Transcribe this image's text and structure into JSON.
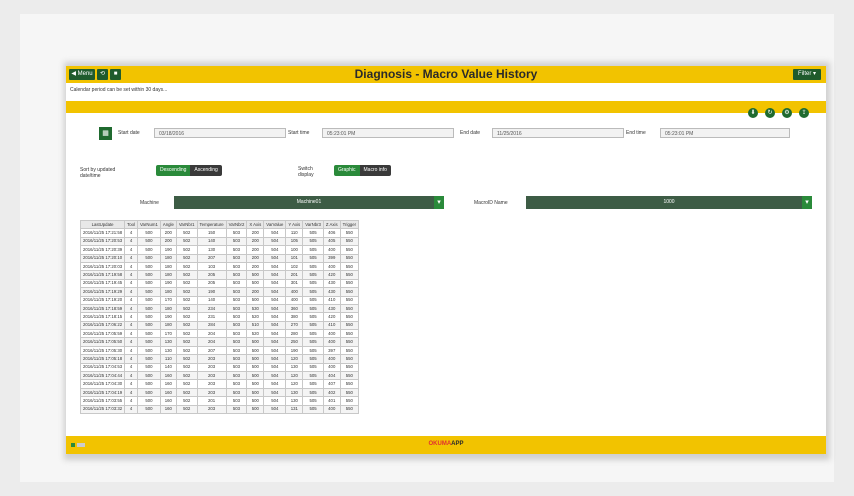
{
  "window": {
    "title": "Diagnosis - Macro Value History",
    "left_buttons": [
      "◀ Menu",
      "⟲",
      "■"
    ],
    "right_button": "Filter ▾",
    "info_text": "Calendar period can be set within 30 days..."
  },
  "toolbar": {
    "icons": [
      "download-icon",
      "refresh-icon",
      "settings-icon",
      "export-icon"
    ]
  },
  "filters": {
    "start_date_label": "Start date",
    "start_date": "03/18/2016",
    "start_time_label": "Start time",
    "start_time": "05:23:01 PM",
    "end_date_label": "End date",
    "end_date": "11/25/2016",
    "end_time_label": "End time",
    "end_time": "05:23:01 PM",
    "sort_label": "Sort by updated date/time",
    "sort_on": "Descending",
    "sort_off": "Ascending",
    "switch_label": "Switch display",
    "switch_on": "Graphic",
    "switch_off": "Macro info",
    "machine_label": "Machine",
    "machine_value": "Machine01",
    "macro_label": "MacroID Name",
    "macro_value": "1000"
  },
  "table": {
    "headers": [
      "LastUpdate",
      "Tool",
      "VarNum1",
      "Angle",
      "VarNbr1",
      "Temperature",
      "VarNbr2",
      "X Axis",
      "VarValue",
      "Y Axis",
      "VarNbr3",
      "Z Axis",
      "Trigger"
    ],
    "rows": [
      [
        "2016/11/25 17:21:58",
        "4",
        "500",
        "200",
        "502",
        "150",
        "503",
        "200",
        "504",
        "110",
        "505",
        "406",
        "550"
      ],
      [
        "2016/11/25 17:20:53",
        "4",
        "500",
        "200",
        "502",
        "140",
        "503",
        "200",
        "504",
        "105",
        "505",
        "405",
        "550"
      ],
      [
        "2016/11/25 17:20:39",
        "4",
        "500",
        "190",
        "502",
        "130",
        "503",
        "200",
        "504",
        "100",
        "505",
        "400",
        "550"
      ],
      [
        "2016/11/25 17:20:10",
        "4",
        "500",
        "180",
        "502",
        "207",
        "503",
        "200",
        "504",
        "101",
        "505",
        "399",
        "550"
      ],
      [
        "2016/11/25 17:20:03",
        "4",
        "500",
        "180",
        "502",
        "103",
        "503",
        "200",
        "504",
        "102",
        "505",
        "400",
        "550"
      ],
      [
        "2016/11/25 17:19:58",
        "4",
        "500",
        "180",
        "502",
        "205",
        "503",
        "500",
        "504",
        "201",
        "505",
        "420",
        "550"
      ],
      [
        "2016/11/25 17:19:45",
        "4",
        "500",
        "190",
        "502",
        "205",
        "503",
        "500",
        "504",
        "301",
        "505",
        "430",
        "550"
      ],
      [
        "2016/11/25 17:19:29",
        "4",
        "500",
        "180",
        "502",
        "190",
        "503",
        "200",
        "504",
        "400",
        "505",
        "430",
        "550"
      ],
      [
        "2016/11/25 17:19:20",
        "4",
        "500",
        "170",
        "502",
        "140",
        "503",
        "500",
        "504",
        "400",
        "505",
        "410",
        "550"
      ],
      [
        "2016/11/25 17:18:59",
        "4",
        "500",
        "180",
        "502",
        "234",
        "503",
        "530",
        "504",
        "360",
        "505",
        "430",
        "550"
      ],
      [
        "2016/11/25 17:18:15",
        "4",
        "500",
        "190",
        "502",
        "231",
        "503",
        "520",
        "504",
        "380",
        "505",
        "420",
        "550"
      ],
      [
        "2016/11/25 17:06:22",
        "4",
        "500",
        "180",
        "502",
        "284",
        "503",
        "510",
        "504",
        "270",
        "505",
        "410",
        "550"
      ],
      [
        "2016/11/25 17:05:59",
        "4",
        "500",
        "170",
        "502",
        "204",
        "503",
        "520",
        "504",
        "280",
        "505",
        "400",
        "550"
      ],
      [
        "2016/11/25 17:05:50",
        "4",
        "500",
        "130",
        "502",
        "204",
        "503",
        "500",
        "504",
        "250",
        "505",
        "400",
        "550"
      ],
      [
        "2016/11/25 17:05:30",
        "4",
        "500",
        "130",
        "502",
        "207",
        "503",
        "500",
        "504",
        "190",
        "505",
        "397",
        "550"
      ],
      [
        "2016/11/25 17:05:18",
        "4",
        "500",
        "110",
        "502",
        "203",
        "503",
        "500",
        "504",
        "120",
        "505",
        "400",
        "550"
      ],
      [
        "2016/11/25 17:04:53",
        "4",
        "500",
        "140",
        "502",
        "203",
        "503",
        "500",
        "504",
        "130",
        "505",
        "400",
        "550"
      ],
      [
        "2016/11/25 17:04:44",
        "4",
        "500",
        "160",
        "502",
        "203",
        "503",
        "500",
        "504",
        "120",
        "505",
        "404",
        "550"
      ],
      [
        "2016/11/25 17:04:30",
        "4",
        "500",
        "160",
        "502",
        "203",
        "503",
        "500",
        "504",
        "120",
        "505",
        "407",
        "550"
      ],
      [
        "2016/11/25 17:04:19",
        "4",
        "500",
        "160",
        "502",
        "203",
        "503",
        "500",
        "504",
        "130",
        "505",
        "402",
        "550"
      ],
      [
        "2016/11/25 17:03:55",
        "4",
        "500",
        "160",
        "502",
        "201",
        "503",
        "500",
        "504",
        "130",
        "505",
        "401",
        "550"
      ],
      [
        "2016/11/25 17:03:32",
        "4",
        "500",
        "160",
        "502",
        "203",
        "503",
        "500",
        "504",
        "131",
        "505",
        "400",
        "550"
      ]
    ]
  },
  "footer": {
    "brand_a": "OKUMA",
    "brand_b": "APP"
  },
  "colors": {
    "accent_yellow": "#f2c300",
    "accent_green": "#1f6a2f"
  }
}
